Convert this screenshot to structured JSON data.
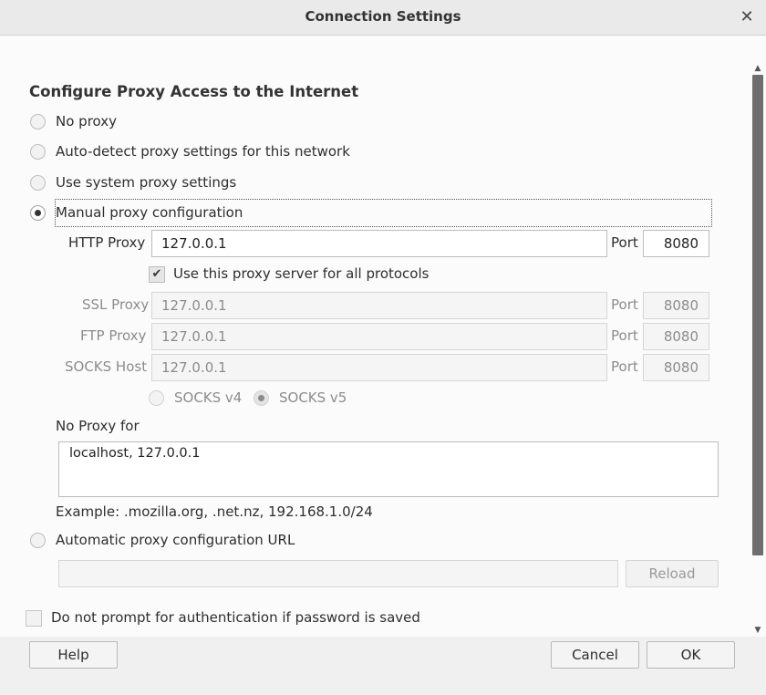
{
  "dialog": {
    "title": "Connection Settings"
  },
  "heading": "Configure Proxy Access to the Internet",
  "options": {
    "no_proxy": "No proxy",
    "auto_detect": "Auto-detect proxy settings for this network",
    "system": "Use system proxy settings",
    "manual": "Manual proxy configuration",
    "auto_url": "Automatic proxy configuration URL",
    "selected": "manual"
  },
  "manual": {
    "http": {
      "label": "HTTP Proxy",
      "value": "127.0.0.1",
      "port_label": "Port",
      "port": "8080"
    },
    "share_all": {
      "label": "Use this proxy server for all protocols",
      "checked": true
    },
    "ssl": {
      "label": "SSL Proxy",
      "value": "127.0.0.1",
      "port_label": "Port",
      "port": "8080"
    },
    "ftp": {
      "label": "FTP Proxy",
      "value": "127.0.0.1",
      "port_label": "Port",
      "port": "8080"
    },
    "socks": {
      "label": "SOCKS Host",
      "value": "127.0.0.1",
      "port_label": "Port",
      "port": "8080"
    },
    "socks_v4": "SOCKS v4",
    "socks_v5": "SOCKS v5",
    "socks_selected": "v5"
  },
  "no_proxy_for": {
    "label": "No Proxy for",
    "value": "localhost, 127.0.0.1",
    "example": "Example: .mozilla.org, .net.nz, 192.168.1.0/24"
  },
  "auto_url": {
    "value": "",
    "reload_label": "Reload"
  },
  "no_auth_prompt": {
    "label": "Do not prompt for authentication if password is saved",
    "checked": false
  },
  "footer": {
    "help": "Help",
    "cancel": "Cancel",
    "ok": "OK"
  },
  "icons": {
    "close": "close-icon",
    "check": "checkmark-icon",
    "scroll_up": "chevron-up-icon",
    "scroll_down": "chevron-down-icon"
  }
}
